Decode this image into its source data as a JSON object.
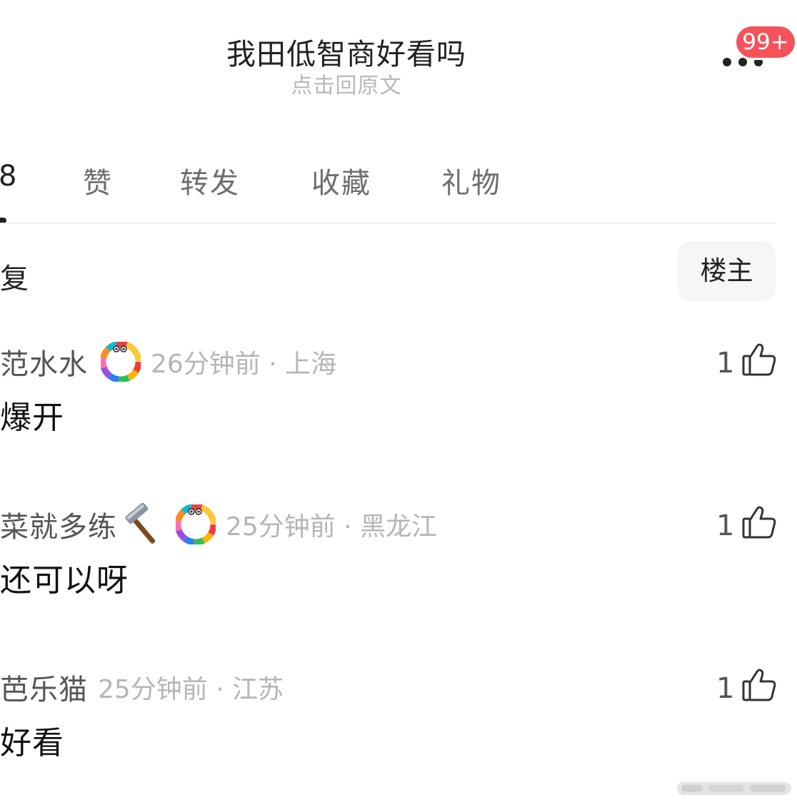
{
  "header": {
    "title": "我田低智商好看吗",
    "subtitle": "点击回原文",
    "badge": "99+"
  },
  "tabs": [
    {
      "label": "8",
      "active": true
    },
    {
      "label": "赞",
      "active": false
    },
    {
      "label": "转发",
      "active": false
    },
    {
      "label": "收藏",
      "active": false
    },
    {
      "label": "礼物",
      "active": false
    }
  ],
  "reply_section": {
    "heading": "复",
    "owner_filter": "楼主"
  },
  "comments": [
    {
      "name": "范水水",
      "time": "26分钟前",
      "location": "上海",
      "meta": "26分钟前 · 上海",
      "text": "爆开",
      "likes": "1",
      "has_medal": true,
      "has_hammer": false
    },
    {
      "name": "菜就多练",
      "time": "25分钟前",
      "location": "黑龙江",
      "meta": "25分钟前 · 黑龙江",
      "text": "还可以呀",
      "likes": "1",
      "has_medal": true,
      "has_hammer": true
    },
    {
      "name": "芭乐猫",
      "time": "25分钟前",
      "location": "江苏",
      "meta": "25分钟前 · 江苏",
      "text": "好看",
      "likes": "1",
      "has_medal": false,
      "has_hammer": false
    }
  ],
  "colors": {
    "badge": "#f4535c",
    "meta_text": "#b5b5b5",
    "name_text": "#555555",
    "owner_button_bg": "#f6f6f6"
  },
  "icons": {
    "more": "more-dots-icon",
    "like": "thumbs-up-icon",
    "medal": "rainbow-medal-icon",
    "hammer": "hammer-icon"
  }
}
